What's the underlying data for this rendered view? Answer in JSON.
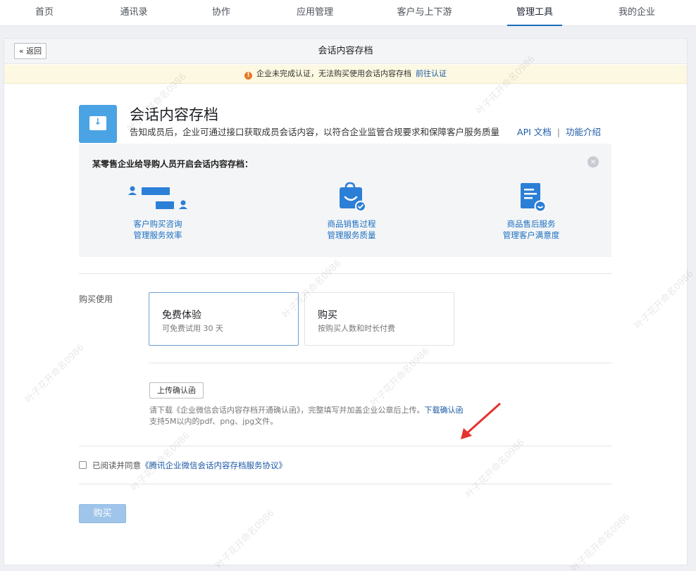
{
  "nav": {
    "tabs": [
      {
        "label": "首页"
      },
      {
        "label": "通讯录"
      },
      {
        "label": "协作"
      },
      {
        "label": "应用管理"
      },
      {
        "label": "客户与上下游"
      },
      {
        "label": "管理工具"
      },
      {
        "label": "我的企业"
      }
    ],
    "active_index": 5
  },
  "header": {
    "back_label": "« 返回",
    "title": "会话内容存档"
  },
  "warning": {
    "text": "企业未完成认证，无法购买使用会话内容存档",
    "link": "前往认证"
  },
  "product": {
    "title": "会话内容存档",
    "description": "告知成员后，企业可通过接口获取成员会话内容，以符合企业监管合规要求和保障客户服务质量",
    "link_api": "API 文档",
    "separator": "|",
    "link_intro": "功能介绍"
  },
  "case": {
    "title": "某零售企业给导购人员开启会话内容存档：",
    "close_icon": "×",
    "items": [
      {
        "line1": "客户购买咨询",
        "line2": "管理服务效率",
        "icon": "chat-icon"
      },
      {
        "line1": "商品销售过程",
        "line2": "管理服务质量",
        "icon": "shopping-bag-icon"
      },
      {
        "line1": "商品售后服务",
        "line2": "管理客户满意度",
        "icon": "document-smile-icon"
      }
    ]
  },
  "purchase": {
    "label": "购买使用",
    "options": [
      {
        "title": "免费体验",
        "subtitle": "可免费试用 30 天",
        "selected": true
      },
      {
        "title": "购买",
        "subtitle": "按购买人数和时长付费",
        "selected": false
      }
    ]
  },
  "upload": {
    "button": "上传确认函",
    "hint_prefix": "请下载《企业微信会话内容存档开通确认函》，完整填写并加盖企业公章后上传。",
    "hint_link": "下载确认函",
    "hint_line2": "支持5M以内的pdf、png、jpg文件。"
  },
  "agreement": {
    "text": "已阅读并同意",
    "link": "《腾讯企业微信会话内容存档服务协议》",
    "checked": false
  },
  "buy_button": "购买",
  "watermark": "叶子花开命名0986",
  "colors": {
    "accent": "#1a6dbb",
    "link": "#1b5aa6",
    "icon_blue": "#4aa3e3",
    "warning_bg": "#fdf8e2",
    "arrow": "#e5322d"
  }
}
